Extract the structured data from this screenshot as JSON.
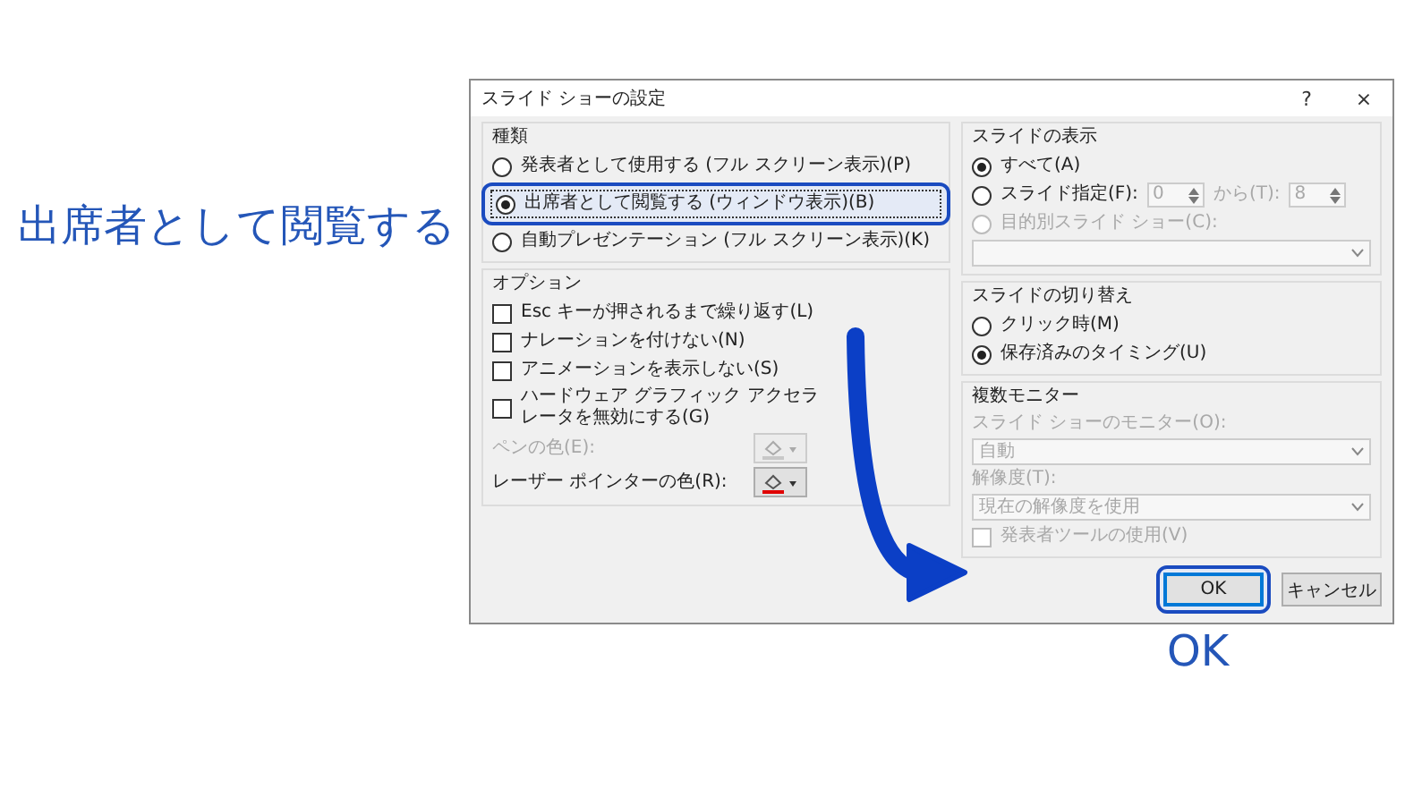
{
  "heading": "出席者として閲覧する",
  "ok_caption": "OK",
  "dialog": {
    "title": "スライド ショーの設定",
    "help": "?",
    "close": "×",
    "show_type": {
      "label": "種類",
      "options": [
        {
          "label": "発表者として使用する (フル スクリーン表示)(P)",
          "selected": false,
          "highlighted": false
        },
        {
          "label": "出席者として閲覧する (ウィンドウ表示)(B)",
          "selected": true,
          "highlighted": true
        },
        {
          "label": "自動プレゼンテーション (フル スクリーン表示)(K)",
          "selected": false,
          "highlighted": false
        }
      ]
    },
    "options": {
      "label": "オプション",
      "checkboxes": [
        {
          "label": "Esc キーが押されるまで繰り返す(L)",
          "checked": false
        },
        {
          "label": "ナレーションを付けない(N)",
          "checked": false
        },
        {
          "label": "アニメーションを表示しない(S)",
          "checked": false
        },
        {
          "label": "ハードウェア グラフィック アクセラレータを無効にする(G)",
          "checked": false
        }
      ],
      "colors": [
        {
          "label": "ペンの色(E):",
          "disabled": true,
          "color": "#c8c8c8"
        },
        {
          "label": "レーザー ポインターの色(R):",
          "disabled": false,
          "color": "#e00000"
        }
      ]
    },
    "slides": {
      "label": "スライドの表示",
      "options": [
        {
          "label": "すべて(A)",
          "selected": true,
          "disabled": false
        },
        {
          "label": "スライド指定(F):",
          "selected": false,
          "disabled": false
        },
        {
          "label": "目的別スライド ショー(C):",
          "selected": false,
          "disabled": true
        }
      ],
      "range": {
        "from": "0",
        "to_label": "から(T):",
        "to": "8"
      }
    },
    "advance": {
      "label": "スライドの切り替え",
      "options": [
        {
          "label": "クリック時(M)",
          "selected": false
        },
        {
          "label": "保存済みのタイミング(U)",
          "selected": true
        }
      ]
    },
    "monitors": {
      "label": "複数モニター",
      "disabled": true,
      "monitor_label": "スライド ショーのモニター(O):",
      "monitor_value": "自動",
      "resolution_label": "解像度(T):",
      "resolution_value": "現在の解像度を使用",
      "presenter_view": {
        "label": "発表者ツールの使用(V)",
        "checked": false
      }
    },
    "buttons": [
      {
        "label": "OK",
        "default": true,
        "highlighted": true
      },
      {
        "label": "キャンセル",
        "default": false,
        "highlighted": false
      }
    ]
  }
}
